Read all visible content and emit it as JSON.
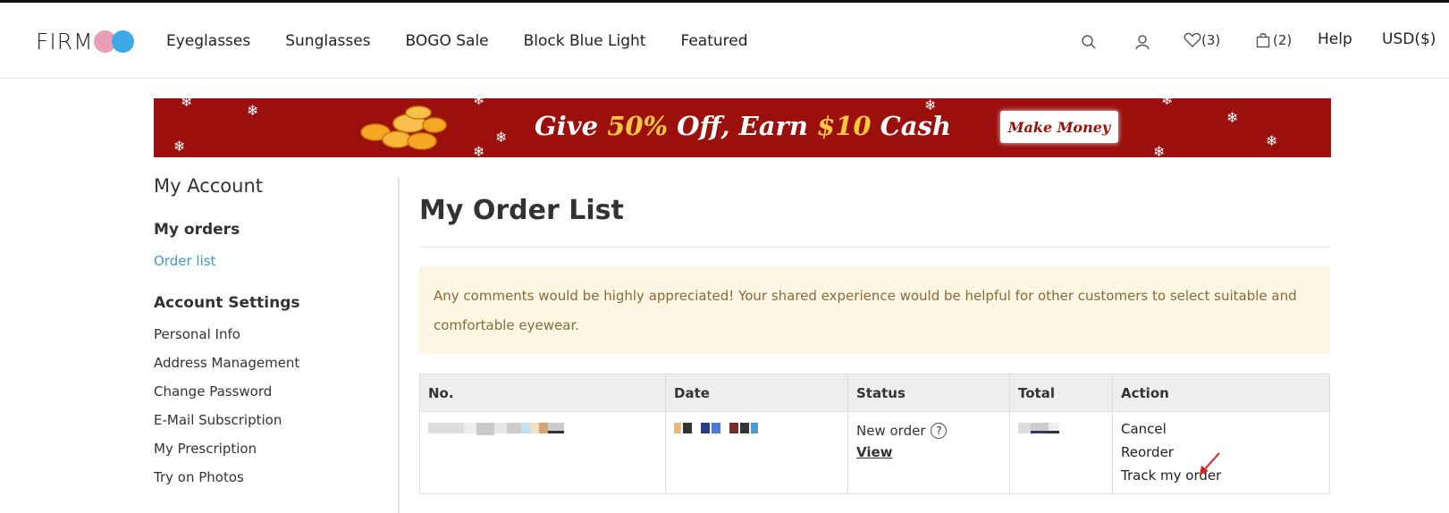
{
  "header": {
    "logo_text": "FIRM",
    "nav": [
      "Eyeglasses",
      "Sunglasses",
      "BOGO Sale",
      "Block Blue Light",
      "Featured"
    ],
    "wishlist_count": "(3)",
    "cart_count": "(2)",
    "help_label": "Help",
    "currency_label": "USD($)",
    "icons": [
      "search-icon",
      "user-icon",
      "heart-icon",
      "bag-icon"
    ]
  },
  "banner": {
    "text_give": "Give ",
    "text_pct": "50%",
    "text_off": " Off, Earn ",
    "text_cash_amt": "$10",
    "text_cash": " Cash",
    "button_label": "Make Money",
    "colors": {
      "background": "#9b0f0c",
      "highlight": "#ffc83d"
    }
  },
  "sidebar": {
    "title": "My Account",
    "section1": "My orders",
    "order_list": "Order list",
    "section2": "Account Settings",
    "links": [
      "Personal Info",
      "Address Management",
      "Change Password",
      "E-Mail Subscription",
      "My Prescription",
      "Try on Photos"
    ]
  },
  "main": {
    "title": "My Order List",
    "notice": "Any comments would be highly appreciated! Your shared experience would be helpful for other customers to select suitable and comfortable eyewear.",
    "table": {
      "headers": [
        "No.",
        "Date",
        "Status",
        "Total",
        "Action"
      ],
      "row": {
        "status": "New order",
        "view_label": "View",
        "actions": [
          "Cancel",
          "Reorder",
          "Track my order"
        ]
      }
    }
  },
  "colors": {
    "link_active": "#3a9ad9",
    "notice_bg": "#fcf6e3"
  }
}
